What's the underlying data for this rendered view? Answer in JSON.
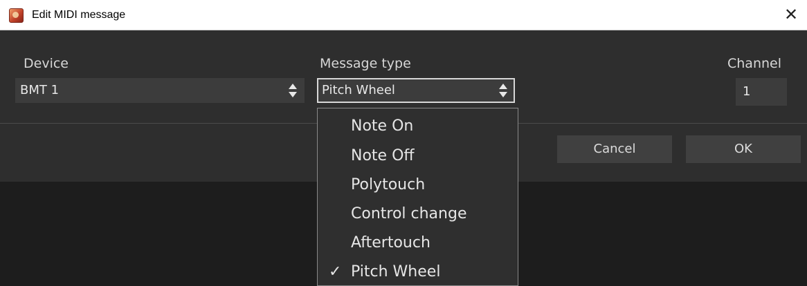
{
  "window": {
    "title": "Edit MIDI message",
    "app_icon": "app-logo-icon",
    "close_glyph": "✕"
  },
  "form": {
    "device_label": "Device",
    "device_value": "BMT 1",
    "message_type_label": "Message type",
    "message_type_value": "Pitch Wheel",
    "channel_label": "Channel",
    "channel_value": "1"
  },
  "buttons": {
    "cancel": "Cancel",
    "ok": "OK"
  },
  "dropdown": {
    "items": [
      {
        "label": "Note On",
        "selected": false
      },
      {
        "label": "Note Off",
        "selected": false
      },
      {
        "label": "Polytouch",
        "selected": false
      },
      {
        "label": "Control change",
        "selected": false
      },
      {
        "label": "Aftertouch",
        "selected": false
      },
      {
        "label": "Pitch Wheel",
        "selected": true
      }
    ],
    "check_glyph": "✓"
  },
  "colors": {
    "panel": "#2e2e2e",
    "field": "#3c3c3c",
    "text": "#e8e8e8",
    "focus_border": "#d8d8d8"
  }
}
